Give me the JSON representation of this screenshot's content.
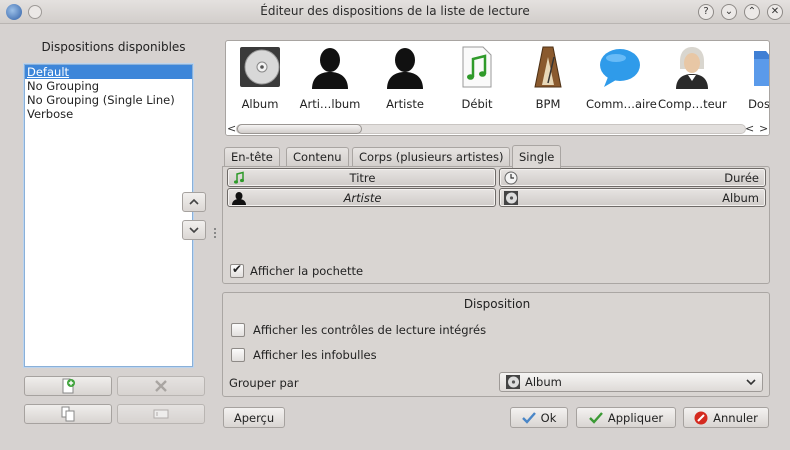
{
  "window": {
    "title": "Éditeur des dispositions de la liste de lecture"
  },
  "left": {
    "heading": "Dispositions disponibles",
    "layouts": [
      "Default",
      "No Grouping",
      "No Grouping (Single Line)",
      "Verbose"
    ],
    "selected_index": 0
  },
  "tokens": [
    {
      "label": "Album",
      "icon": "cd-icon"
    },
    {
      "label": "Arti…lbum",
      "icon": "person-silhouette-icon"
    },
    {
      "label": "Artiste",
      "icon": "person-silhouette-icon"
    },
    {
      "label": "Débit",
      "icon": "music-file-icon"
    },
    {
      "label": "BPM",
      "icon": "metronome-icon"
    },
    {
      "label": "Comm…aire",
      "icon": "speech-bubble-icon"
    },
    {
      "label": "Comp…teur",
      "icon": "composer-portrait-icon"
    },
    {
      "label": "Doss",
      "icon": "folder-icon"
    }
  ],
  "tabs": [
    "En-tête",
    "Contenu",
    "Corps (plusieurs artistes)",
    "Single"
  ],
  "active_tab": 3,
  "layout_fields": [
    {
      "label": "Titre",
      "icon": "music-note-icon",
      "align": "center",
      "italic": false
    },
    {
      "label": "Durée",
      "icon": "clock-icon",
      "align": "right",
      "italic": false
    },
    {
      "label": "Artiste",
      "icon": "person-icon",
      "align": "center",
      "italic": true
    },
    {
      "label": "Album",
      "icon": "cd-icon",
      "align": "right",
      "italic": false
    }
  ],
  "show_cover": {
    "label": "Afficher la pochette",
    "checked": true
  },
  "disposition": {
    "title": "Disposition",
    "inline_controls": {
      "label": "Afficher les contrôles de lecture intégrés",
      "checked": false
    },
    "tooltips": {
      "label": "Afficher les infobulles",
      "checked": false
    },
    "group_by_label": "Grouper par",
    "group_by_value": "Album"
  },
  "buttons": {
    "preview": "Aperçu",
    "ok": "Ok",
    "apply": "Appliquer",
    "cancel": "Annuler"
  }
}
